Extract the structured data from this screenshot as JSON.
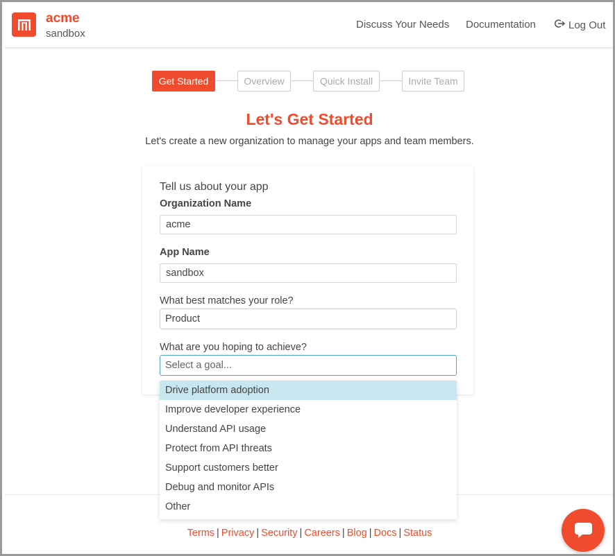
{
  "header": {
    "org_name": "acme",
    "app_name": "sandbox",
    "logo_icon": "acme-logo-icon",
    "nav": {
      "discuss": "Discuss Your Needs",
      "documentation": "Documentation",
      "logout": "Log Out"
    }
  },
  "steps": [
    {
      "label": "Get Started",
      "active": true
    },
    {
      "label": "Overview",
      "active": false
    },
    {
      "label": "Quick Install",
      "active": false
    },
    {
      "label": "Invite Team",
      "active": false
    }
  ],
  "page": {
    "title": "Let's Get Started",
    "subtitle": "Let's create a new organization to manage your apps and team members."
  },
  "form": {
    "heading": "Tell us about your app",
    "org_label": "Organization Name",
    "org_value": "acme",
    "app_label": "App Name",
    "app_value": "sandbox",
    "role_label": "What best matches your role?",
    "role_value": "Product",
    "goal_label": "What are you hoping to achieve?",
    "goal_placeholder": "Select a goal..."
  },
  "goal_options": [
    "Drive platform adoption",
    "Improve developer experience",
    "Understand API usage",
    "Protect from API threats",
    "Support customers better",
    "Debug and monitor APIs",
    "Other"
  ],
  "highlighted_option": "Drive platform adoption",
  "footer": {
    "links": [
      "Terms",
      "Privacy",
      "Security",
      "Careers",
      "Blog",
      "Docs",
      "Status"
    ],
    "separator": "|"
  },
  "colors": {
    "accent": "#ef4b2c",
    "highlight": "#c7e6ef",
    "focus_border": "#4aa9c4"
  },
  "chat": {
    "icon": "chat-bubble-icon"
  }
}
